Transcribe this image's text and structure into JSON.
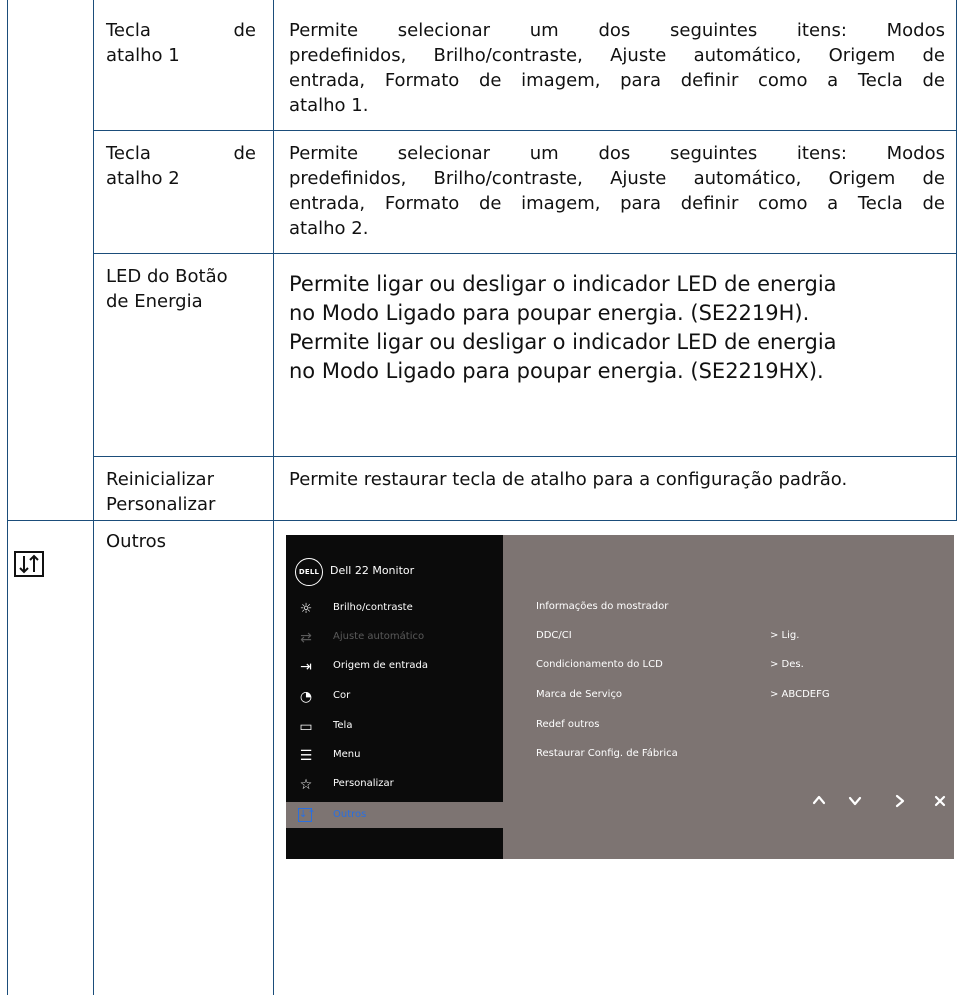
{
  "rows": [
    {
      "label_line1_left": "Tecla",
      "label_line1_right": "de",
      "label_line2": "atalho 1",
      "description_lines": [
        "Permite selecionar um dos seguintes itens: Modos",
        "predefinidos, Brilho/contraste, Ajuste automático, Origem de",
        "entrada, Formato de imagem, para definir como a Tecla de",
        "atalho 1."
      ]
    },
    {
      "label_line1_left": "Tecla",
      "label_line1_right": "de",
      "label_line2": "atalho 2",
      "description_lines": [
        "Permite selecionar um dos seguintes itens: Modos",
        "predefinidos, Brilho/contraste, Ajuste automático, Origem de",
        "entrada, Formato de imagem, para definir como a Tecla de",
        "atalho 2."
      ]
    },
    {
      "label_line1": "LED do Botão",
      "label_line2": "de Energia",
      "description_lines": [
        "Permite ligar ou desligar o indicador LED de energia",
        "no Modo Ligado para poupar energia. (SE2219H).",
        "Permite ligar ou desligar o indicador LED de energia",
        "no Modo Ligado para poupar energia. (SE2219HX)."
      ]
    },
    {
      "label_line1": "Reinicializar",
      "label_line2": "Personalizar",
      "description": "Permite restaurar tecla de atalho para a configuração padrão."
    }
  ],
  "outros": {
    "label": "Outros",
    "icon": "sort-arrows-icon"
  },
  "osd": {
    "logo_text": "DELL",
    "title": "Dell 22 Monitor",
    "menu": [
      {
        "label": "Brilho/contraste",
        "icon": "sun-icon",
        "state": "normal"
      },
      {
        "label": "Ajuste automático",
        "icon": "auto-adjust-icon",
        "state": "dim"
      },
      {
        "label": "Origem de entrada",
        "icon": "input-icon",
        "state": "normal"
      },
      {
        "label": "Cor",
        "icon": "palette-icon",
        "state": "normal"
      },
      {
        "label": "Tela",
        "icon": "display-icon",
        "state": "normal"
      },
      {
        "label": "Menu",
        "icon": "menu-list-icon",
        "state": "normal"
      },
      {
        "label": "Personalizar",
        "icon": "star-icon",
        "state": "normal"
      },
      {
        "label": "Outros",
        "icon": "others-icon",
        "state": "selected"
      }
    ],
    "options": [
      {
        "label": "Informações do mostrador",
        "value": ""
      },
      {
        "label": "DDC/CI",
        "value": "> Lig."
      },
      {
        "label": "Condicionamento do LCD",
        "value": "> Des."
      },
      {
        "label": "Marca de Serviço",
        "value": "> ABCDEFG"
      },
      {
        "label": "Redef outros",
        "value": ""
      },
      {
        "label": "Restaurar Config. de Fábrica",
        "value": ""
      }
    ],
    "nav_buttons": [
      "up-icon",
      "down-icon",
      "right-icon",
      "close-icon"
    ],
    "colors": {
      "panel_dark": "#0b0b0b",
      "panel_gray": "#7d7472",
      "highlight": "#2a6fe0",
      "table_line": "#1b4d7a"
    }
  }
}
